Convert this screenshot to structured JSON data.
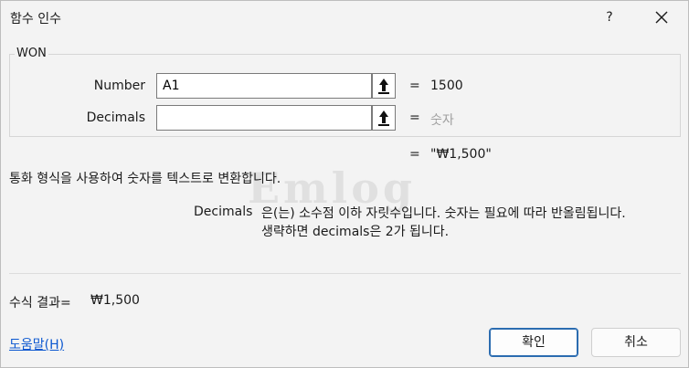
{
  "window": {
    "title": "함수 인수",
    "help_glyph": "?"
  },
  "function_group": {
    "name": "WON"
  },
  "arguments": [
    {
      "label": "Number",
      "value": "A1",
      "equals": "=",
      "result": "1500"
    },
    {
      "label": "Decimals",
      "value": "",
      "equals": "=",
      "result": "숫자"
    }
  ],
  "overall_result": {
    "equals": "=",
    "value": "\"₩1,500\""
  },
  "description": {
    "main": "통화 형식을 사용하여 숫자를 텍스트로 변환합니다.",
    "arg_name": "Decimals",
    "arg_text_line1": "은(는) 소수점 이하 자릿수입니다. 숫자는 필요에 따라 반올림됩니다.",
    "arg_text_line2": "생략하면 decimals은 2가 됩니다."
  },
  "formula_result": {
    "label": "수식 결과=",
    "value": "₩1,500"
  },
  "footer": {
    "help_link": "도움말(H)",
    "ok_label": "확인",
    "cancel_label": "취소"
  },
  "watermark": "Emlog",
  "colors": {
    "link": "#0b57d0",
    "primary_border": "#2b6cb0",
    "muted": "#a0a0a0"
  }
}
